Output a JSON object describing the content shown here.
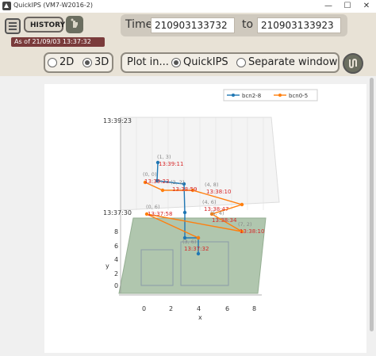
{
  "window": {
    "title": "QuickIPS (VM7-W2016-2)",
    "minimize": "—",
    "maximize": "☐",
    "close": "✕"
  },
  "toolbar": {
    "history_label": "HISTORY",
    "as_of": "As of 21/09/03 13:37:32",
    "time_label": "Time",
    "time_from": "210903133732",
    "to_label": "to",
    "time_to": "210903133923"
  },
  "controls": {
    "view_2d": "2D",
    "view_3d": "3D",
    "plot_in_label": "Plot in...",
    "quickips": "QuickIPS",
    "separate": "Separate window"
  },
  "colors": {
    "series1": "#1f77b4",
    "series2": "#ff7f0e",
    "label": "#d62728",
    "accent": "#7a3b3b"
  },
  "chart_data": {
    "type": "line",
    "legend": [
      "bcn2-8",
      "bcn0-5"
    ],
    "z_ticks": [
      "13:39:23",
      "13:37:30"
    ],
    "x_ticks": [
      "0",
      "2",
      "4",
      "6",
      "8"
    ],
    "y_ticks": [
      "0",
      "2",
      "4",
      "6",
      "8"
    ],
    "xlabel": "x",
    "ylabel": "y",
    "annotations": [
      {
        "coord": "(1, 3)",
        "time": "13:39:11",
        "series": "bcn2-8"
      },
      {
        "coord": "(0, 0)",
        "time": "13:39:23",
        "series": "bcn0-5"
      },
      {
        "coord": "(2, 2)",
        "time": "13:38:59",
        "series": "bcn0-5"
      },
      {
        "coord": "(4, 8)",
        "time": "13:38:10",
        "series": "bcn0-5"
      },
      {
        "coord": "(0, 6)",
        "time": "13:37:58",
        "series": "bcn0-5"
      },
      {
        "coord": "(4, 6)",
        "time": "13:38:47",
        "series": "bcn2-8"
      },
      {
        "coord": "(5, 4)",
        "time": "13:38:34",
        "series": "bcn0-5"
      },
      {
        "coord": "(7, 2)",
        "time": "13:38:10",
        "series": "bcn0-5"
      },
      {
        "coord": "(3, 6)",
        "time": "13:37:32",
        "series": "bcn2-8"
      }
    ]
  }
}
